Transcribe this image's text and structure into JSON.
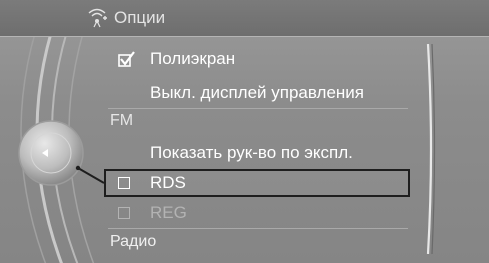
{
  "header": {
    "title": "Опции",
    "icon": "radio-signal-icon"
  },
  "menu": {
    "items": [
      {
        "label": "Полиэкран",
        "checked": true
      },
      {
        "label": "Выкл. дисплей управления"
      }
    ],
    "fm_section": {
      "heading": "FM",
      "items": [
        {
          "label": "Показать рук-во по экспл."
        },
        {
          "label": "RDS",
          "checked": false,
          "selected": true
        },
        {
          "label": "REG",
          "checked": false,
          "enabled": false
        }
      ]
    },
    "footer_item": "Радио"
  },
  "colors": {
    "background": "#8e8e8e",
    "title_bar": "#727272",
    "text": "#ffffff",
    "disabled_text": "#b3b3b3",
    "selection_border": "#1e1e1e"
  }
}
